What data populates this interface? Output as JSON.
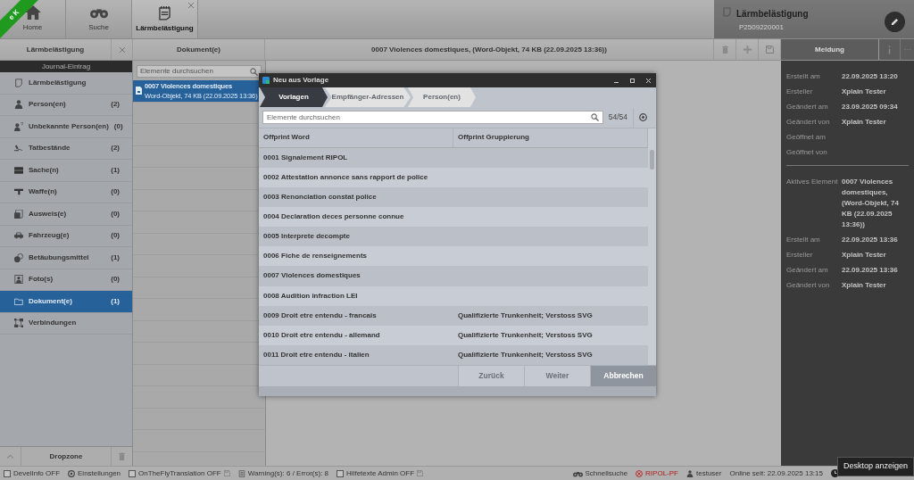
{
  "env_badge": "e K",
  "app_tabs": [
    {
      "label": "Home",
      "selected": false,
      "closable": false
    },
    {
      "label": "Suche",
      "selected": false,
      "closable": false
    },
    {
      "label": "Lärmbelästigung",
      "selected": true,
      "closable": true
    }
  ],
  "case_header": {
    "title": "Lärmbelästigung",
    "number": "P2509220001"
  },
  "subheader": {
    "left_title": "Lärmbelästigung",
    "middle_title": "Dokument(e)",
    "document_title": "0007 Violences domestiques, (Word-Objekt, 74 KB (22.09.2025 13:36))",
    "right_tab": "Meldung"
  },
  "sidebar": {
    "header": "Journal-Eintrag",
    "items": [
      {
        "label": "Lärmbelästigung",
        "selected": false
      },
      {
        "label": "Person(en)",
        "count": "(2)",
        "selected": false
      },
      {
        "label": "Unbekannte Person(en)",
        "count": "(0)",
        "selected": false
      },
      {
        "label": "Tatbestände",
        "count": "(2)",
        "selected": false
      },
      {
        "label": "Sache(n)",
        "count": "(1)",
        "selected": false
      },
      {
        "label": "Waffe(n)",
        "count": "(0)",
        "selected": false
      },
      {
        "label": "Ausweis(e)",
        "count": "(0)",
        "selected": false
      },
      {
        "label": "Fahrzeug(e)",
        "count": "(0)",
        "selected": false
      },
      {
        "label": "Betäubungsmittel",
        "count": "(1)",
        "selected": false
      },
      {
        "label": "Foto(s)",
        "count": "(0)",
        "selected": false
      },
      {
        "label": "Dokument(e)",
        "count": "(1)",
        "selected": true
      },
      {
        "label": "Verbindungen",
        "selected": false
      }
    ],
    "dropzone": "Dropzone"
  },
  "document_list": {
    "placeholder": "Elemente durchsuchen",
    "items": [
      {
        "title": "0007 Violences domestiques",
        "subtitle": "Word-Objekt, 74 KB (22.09.2025 13:36)",
        "selected": true
      }
    ]
  },
  "properties": [
    {
      "label": "Erstellt am",
      "value": "22.09.2025 13:20"
    },
    {
      "label": "Ersteller",
      "value": "Xplain Tester"
    },
    {
      "label": "Geändert am",
      "value": "23.09.2025 09:34"
    },
    {
      "label": "Geändert von",
      "value": "Xplain Tester"
    },
    {
      "label": "Geöffnet am"
    },
    {
      "label": "Geöffnet von"
    }
  ],
  "active_element_properties": [
    {
      "label": "Aktives Element",
      "value": "0007 Violences domestiques, (Word-Objekt, 74 KB (22.09.2025 13:36))"
    },
    {
      "label": "Erstellt am",
      "value": "22.09.2025 13:36"
    },
    {
      "label": "Ersteller",
      "value": "Xplain Tester"
    },
    {
      "label": "Geändert am",
      "value": "22.09.2025 13:36"
    },
    {
      "label": "Geändert von",
      "value": "Xplain Tester"
    }
  ],
  "dialog": {
    "title": "Neu aus Vorlage",
    "steps": [
      {
        "label": "Vorlagen",
        "selected": true
      },
      {
        "label": "Empfänger-Adressen",
        "selected": false
      },
      {
        "label": "Person(en)",
        "selected": false
      }
    ],
    "placeholder": "Elemente durchsuchen",
    "count": "54/54",
    "columns": [
      "Offprint Word",
      "Offprint Gruppierung"
    ],
    "rows": [
      [
        "0001 Signalement RIPOL"
      ],
      [
        "0002 Attestation annonce sans rapport de police"
      ],
      [
        "0003 Renonciation constat police"
      ],
      [
        "0004 Declaration deces personne connue"
      ],
      [
        "0005 Interprete decompte"
      ],
      [
        "0006 Fiche de renseignements"
      ],
      [
        "0007 Violences domestiques"
      ],
      [
        "0008 Audition infraction LEI"
      ],
      [
        "0009 Droit etre entendu - francais",
        "Qualifizierte Trunkenheit; Verstoss SVG"
      ],
      [
        "0010 Droit etre entendu - allemand",
        "Qualifizierte Trunkenheit; Verstoss SVG"
      ],
      [
        "0011 Droit etre entendu - italien",
        "Qualifizierte Trunkenheit; Verstoss SVG"
      ]
    ],
    "buttons": [
      {
        "label": "Zurück",
        "disabled": true
      },
      {
        "label": "Weiter",
        "disabled": true
      },
      {
        "label": "Abbrechen",
        "disabled": false
      }
    ]
  },
  "status_bar": [
    {
      "kind": "toggle",
      "label": "DevelInfo OFF",
      "checked": false
    },
    {
      "kind": "icon",
      "label": "Einstellungen"
    },
    {
      "kind": "toggle",
      "label": "OnTheFlyTranslation OFF",
      "checked": false
    },
    {
      "kind": "icon",
      "label": "Warning(s): 6 / Error(s): 8"
    },
    {
      "kind": "toggle",
      "label": "Hilfetexte Admin OFF",
      "checked": false
    },
    {
      "kind": "icon",
      "label": "Schnellsuche",
      "error": false
    },
    {
      "kind": "icon",
      "label": "RIPOL-PF",
      "error": true
    },
    {
      "kind": "icon",
      "label": "testuser",
      "error": false
    },
    {
      "kind": "text",
      "label": "Online seit: 22.09.2025 13:15"
    }
  ],
  "tooltip": "Desktop anzeigen"
}
